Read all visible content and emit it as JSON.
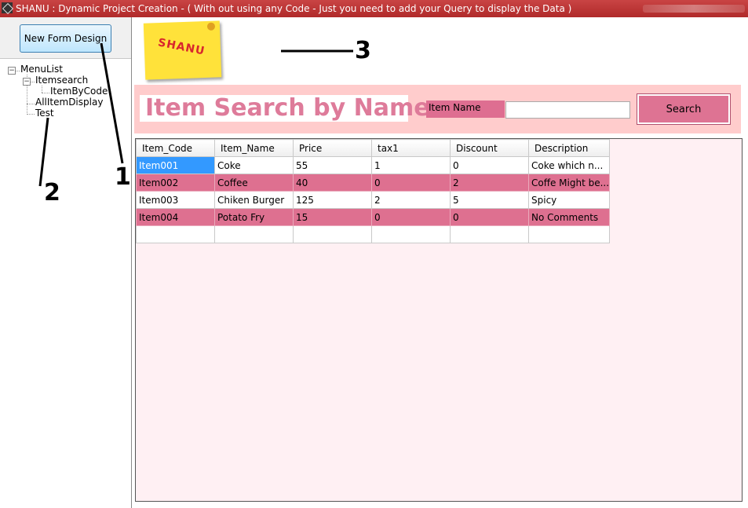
{
  "window": {
    "title": "SHANU : Dynamic Project Creation  - ( With out using any Code -  Just you need to add your Query to display the Data )"
  },
  "sidebar": {
    "new_form_button": "New Form Design",
    "tree": {
      "root": "MenuList",
      "items": [
        {
          "label": "Itemsearch",
          "children": [
            {
              "label": "ItemByCode"
            }
          ]
        },
        {
          "label": "AllItemDisplay"
        },
        {
          "label": "Test"
        }
      ]
    }
  },
  "annotations": {
    "one": "1",
    "two": "2",
    "three": "3"
  },
  "logo": {
    "text": "SHANU"
  },
  "search": {
    "heading": "Item Search by Name",
    "field_label": "Item Name",
    "field_value": "",
    "button_label": "Search"
  },
  "grid": {
    "columns": [
      "Item_Code",
      "Item_Name",
      "Price",
      "tax1",
      "Discount",
      "Description"
    ],
    "rows": [
      [
        "Item001",
        "Coke",
        "55",
        "1",
        "0",
        "Coke which n..."
      ],
      [
        "Item002",
        "Coffee",
        "40",
        "0",
        "2",
        "Coffe Might be..."
      ],
      [
        "Item003",
        "Chiken Burger",
        "125",
        "2",
        "5",
        "Spicy"
      ],
      [
        "Item004",
        "Potato Fry",
        "15",
        "0",
        "0",
        "No Comments"
      ]
    ]
  },
  "colors": {
    "title_bar": "#b02a2a",
    "search_panel": "#ffcccc",
    "heading_text": "#de7b9a",
    "alt_row": "#de7090",
    "selection": "#3399ff"
  }
}
